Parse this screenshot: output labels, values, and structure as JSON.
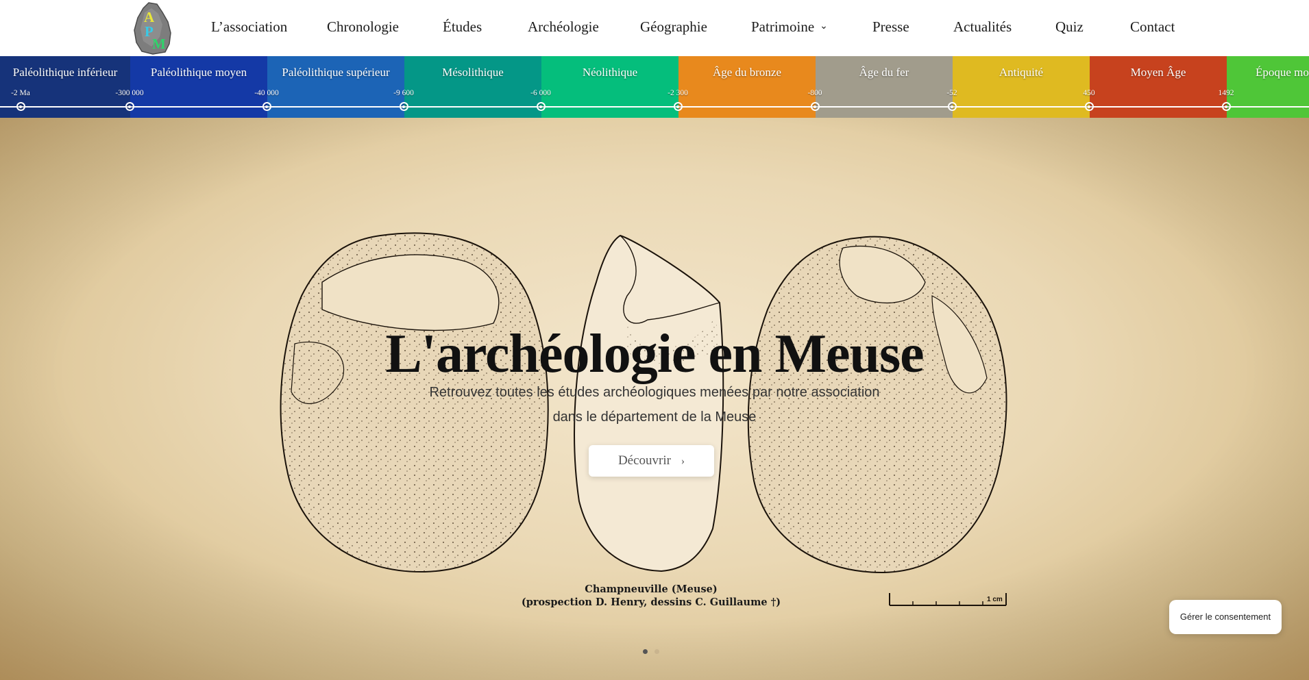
{
  "logo": {
    "letters": [
      "A",
      "P",
      "M"
    ]
  },
  "nav": {
    "items": [
      {
        "label": "L’association"
      },
      {
        "label": "Chronologie"
      },
      {
        "label": "Études"
      },
      {
        "label": "Archéologie"
      },
      {
        "label": "Géographie"
      },
      {
        "label": "Patrimoine",
        "has_dropdown": true
      },
      {
        "label": "Presse"
      },
      {
        "label": "Actualités"
      },
      {
        "label": "Quiz"
      },
      {
        "label": "Contact"
      }
    ]
  },
  "timeline": {
    "periods": [
      {
        "label": "Paléolithique inférieur",
        "color": "#16337a"
      },
      {
        "label": "Paléolithique moyen",
        "color": "#1439a6"
      },
      {
        "label": "Paléolithique supérieur",
        "color": "#1c64b6"
      },
      {
        "label": "Mésolithique",
        "color": "#049787"
      },
      {
        "label": "Néolithique",
        "color": "#05be7c"
      },
      {
        "label": "Âge du bronze",
        "color": "#e8891d"
      },
      {
        "label": "Âge du fer",
        "color": "#a19c8c"
      },
      {
        "label": "Antiquité",
        "color": "#dfba21"
      },
      {
        "label": "Moyen Âge",
        "color": "#c7421e"
      },
      {
        "label": "Époque mo",
        "color": "#4fc638"
      }
    ],
    "ticks": [
      "-2 Ma",
      "-300 000",
      "-40 000",
      "-9 600",
      "-6 000",
      "-2 300",
      "-800",
      "-52",
      "450",
      "1492"
    ]
  },
  "hero": {
    "title": "L'archéologie en Meuse",
    "subtitle_line1": "Retrouvez toutes les études archéologiques menées par notre association",
    "subtitle_line2": "dans le département de la Meuse",
    "cta_label": "Découvrir",
    "caption_line1": "Champneuville (Meuse)",
    "caption_line2": "(prospection D. Henry, dessins C. Guillaume †)",
    "scale_label": "1 cm",
    "slide_count": 2,
    "active_slide": 1
  },
  "consent": {
    "label": "Gérer le consentement"
  }
}
